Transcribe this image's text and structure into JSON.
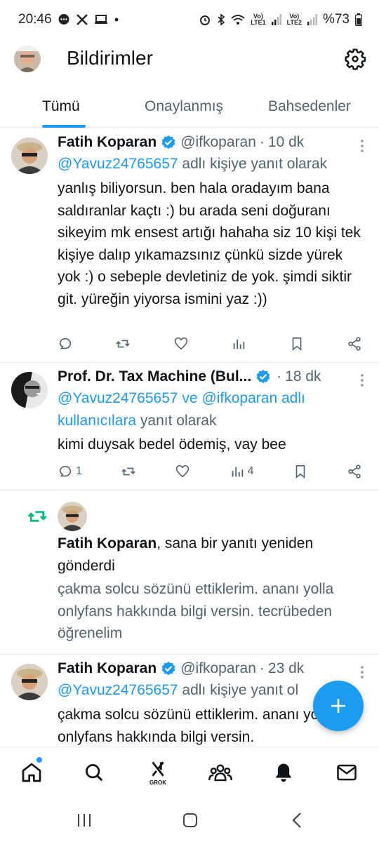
{
  "status_bar": {
    "time": "20:46",
    "notif_icons": [
      "chat-bubble-icon",
      "x-logo-icon",
      "laptop-icon",
      "dot-icon"
    ],
    "sim1_label_top": "Vo)",
    "sim1_label_bottom": "LTE1",
    "sim2_label_top": "Vo)",
    "sim2_label_bottom": "LTE2",
    "battery": "%73"
  },
  "header": {
    "title": "Bildirimler"
  },
  "tabs": [
    {
      "label": "Tümü",
      "active": true
    },
    {
      "label": "Onaylanmış",
      "active": false
    },
    {
      "label": "Bahsedenler",
      "active": false
    }
  ],
  "feed": {
    "tweet1": {
      "name": "Fatih Koparan",
      "handle": "@ifkoparan",
      "dot": "·",
      "time": "10 dk",
      "reply_mention": "@Yavuz24765657",
      "reply_suffix": " adlı kişiye yanıt olarak",
      "text": "yanlış biliyorsun. ben hala oradayım bana saldıranlar kaçtı :) bu arada seni doğuranı sikeyim mk ensest artığı hahaha siz 10 kişi tek kişiye dalıp yıkamazsınız çünkü sizde yürek yok :) o sebeple devletiniz de yok. şimdi siktir git. yüreğin yiyorsa ismini yaz :))"
    },
    "tweet2": {
      "name": "Prof. Dr. Tax Machine (Bul...",
      "dot": "·",
      "time": "18 dk",
      "reply_mention1": "@Yavuz24765657",
      "reply_mid": " ve ",
      "reply_mention2": "@ifkoparan adlı kullanıcılara",
      "reply_suffix": " yanıt olarak",
      "text": "kimi duysak bedel ödemiş, vay bee",
      "reply_count": "1",
      "views_count": "4"
    },
    "retweet_notification": {
      "name": "Fatih Koparan",
      "action": ", sana bir yanıtı yeniden gönderdi",
      "quote": "çakma solcu sözünü ettiklerim. ananı yolla onlyfans hakkında bilgi versin. tecrübeden öğrenelim"
    },
    "tweet3": {
      "name": "Fatih Koparan",
      "handle": "@ifkoparan",
      "dot": "·",
      "time": "23 dk",
      "reply_mention": "@Yavuz24765657",
      "reply_suffix": " adlı kişiye yanıt ol",
      "text": "çakma solcu sözünü ettiklerim. ananı yolla onlyfans hakkında bilgi versin."
    }
  },
  "bottom_nav": {
    "items": [
      "home-icon",
      "search-icon",
      "grok-icon",
      "communities-icon",
      "notifications-icon",
      "messages-icon"
    ],
    "grok_label": "GROK"
  },
  "colors": {
    "accent": "#1d9bf0",
    "retweet_green": "#00ba7c",
    "secondary_text": "#536471"
  }
}
